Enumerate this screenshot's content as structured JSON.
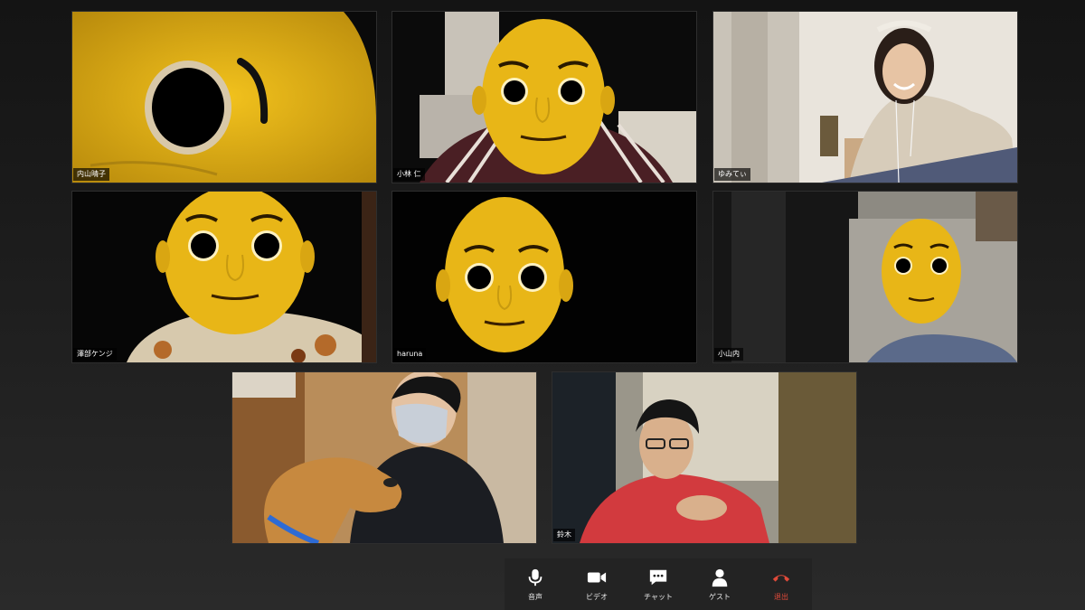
{
  "participants": [
    {
      "name": "内山晴子"
    },
    {
      "name": "小林 仁"
    },
    {
      "name": "ゆみてぃ"
    },
    {
      "name": "澤部ケンジ"
    },
    {
      "name": "haruna"
    },
    {
      "name": "小山内"
    },
    {
      "name": ""
    },
    {
      "name": "鈴木"
    }
  ],
  "toolbar": {
    "mic_label": "音声",
    "video_label": "ビデオ",
    "chat_label": "チャット",
    "guest_label": "ゲスト",
    "leave_label": "退出"
  },
  "icons": {
    "mic": "microphone-icon",
    "video": "video-camera-icon",
    "chat": "chat-bubble-icon",
    "guest": "person-icon",
    "leave": "phone-hangup-icon"
  },
  "colors": {
    "mask_yellow": "#e8b617",
    "toolbar_bg": "#232323",
    "leave_red": "#e04a3a"
  }
}
